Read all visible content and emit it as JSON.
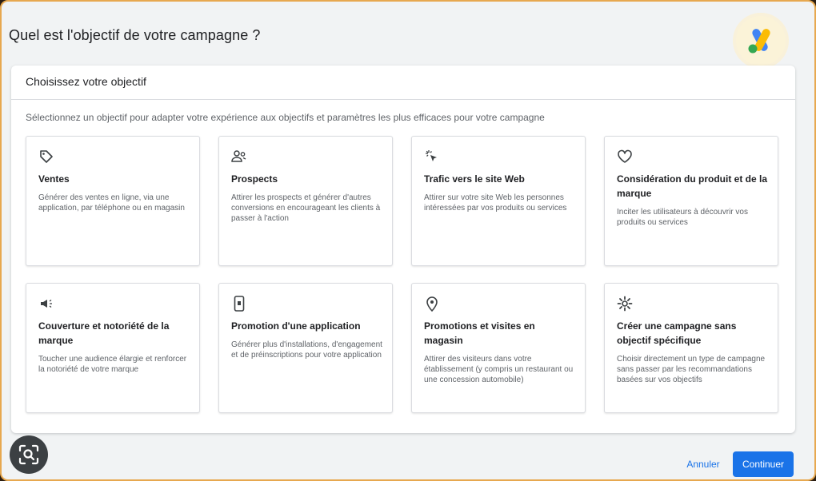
{
  "page": {
    "title": "Quel est l'objectif de votre campagne ?"
  },
  "panel": {
    "header": "Choisissez votre objectif",
    "subtitle": "Sélectionnez un objectif pour adapter votre expérience aux objectifs et paramètres les plus efficaces pour votre campagne"
  },
  "objectives": [
    {
      "icon": "tag-icon",
      "title": "Ventes",
      "desc": "Générer des ventes en ligne, via une application, par téléphone ou en magasin"
    },
    {
      "icon": "people-icon",
      "title": "Prospects",
      "desc": "Attirer les prospects et générer d'autres conversions en encourageant les clients à passer à l'action"
    },
    {
      "icon": "cursor-click-icon",
      "title": "Trafic vers le site Web",
      "desc": "Attirer sur votre site Web les personnes intéressées par vos produits ou services"
    },
    {
      "icon": "heart-icon",
      "title": "Considération du produit et de la marque",
      "desc": "Inciter les utilisateurs à découvrir vos produits ou services"
    },
    {
      "icon": "megaphone-icon",
      "title": "Couverture et notoriété de la marque",
      "desc": "Toucher une audience élargie et renforcer la notoriété de votre marque"
    },
    {
      "icon": "phone-icon",
      "title": "Promotion d'une application",
      "desc": "Générer plus d'installations, d'engagement et de préinscriptions pour votre application"
    },
    {
      "icon": "location-pin-icon",
      "title": "Promotions et visites en magasin",
      "desc": "Attirer des visiteurs dans votre établissement (y compris un restaurant ou une concession automobile)"
    },
    {
      "icon": "gear-icon",
      "title": "Créer une campagne sans objectif spécifique",
      "desc": "Choisir directement un type de campagne sans passer par les recommandations basées sur vos objectifs"
    }
  ],
  "actions": {
    "cancel": "Annuler",
    "continue": "Continuer"
  },
  "colors": {
    "accent": "#1a73e8",
    "frame_border": "#e7a84f"
  }
}
